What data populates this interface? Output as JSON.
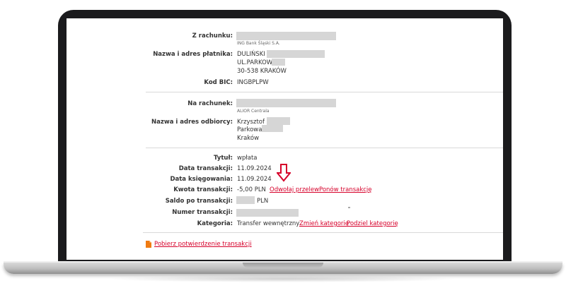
{
  "from_account": {
    "label": "Z rachunku:",
    "bank": "ING Bank Śląski S.A."
  },
  "payer": {
    "label": "Nazwa i adres płatnika:",
    "line1": "DULIŃSKI",
    "line2": "UL.PARKOWA",
    "line3": "30-538 KRAKÓW"
  },
  "bic": {
    "label": "Kod BIC:",
    "value": "INGBPLPW"
  },
  "to_account": {
    "label": "Na rachunek:",
    "bank": "ALIOR Centrala"
  },
  "recipient": {
    "label": "Nazwa i adres odbiorcy:",
    "line1": "Krzysztof",
    "line2": "Parkowa",
    "line3": "Kraków"
  },
  "title": {
    "label": "Tytuł:",
    "value": "wpłata"
  },
  "transaction_date": {
    "label": "Data transakcji:",
    "value": "11.09.2024"
  },
  "posting_date": {
    "label": "Data księgowania:",
    "value": "11.09.2024"
  },
  "amount": {
    "label": "Kwota transakcji:",
    "value": "-5,00 PLN",
    "cancel_link": "Odwołaj przelew",
    "repeat_link": "Ponów transakcję"
  },
  "balance": {
    "label": "Saldo po transakcji:",
    "currency": "PLN"
  },
  "transaction_number": {
    "label": "Numer transakcji:"
  },
  "category": {
    "label": "Kategoria:",
    "value": "Transfer wewnętrzny",
    "change_link": "Zmień kategorię",
    "split_link": "Podziel kategorię"
  },
  "download": {
    "label": "Pobierz potwierdzenie transakcji"
  },
  "colors": {
    "accent": "#d6002a",
    "pdf_icon": "#f07b12"
  },
  "icons": {
    "arrow": "down-arrow-icon",
    "pdf": "pdf-icon"
  }
}
